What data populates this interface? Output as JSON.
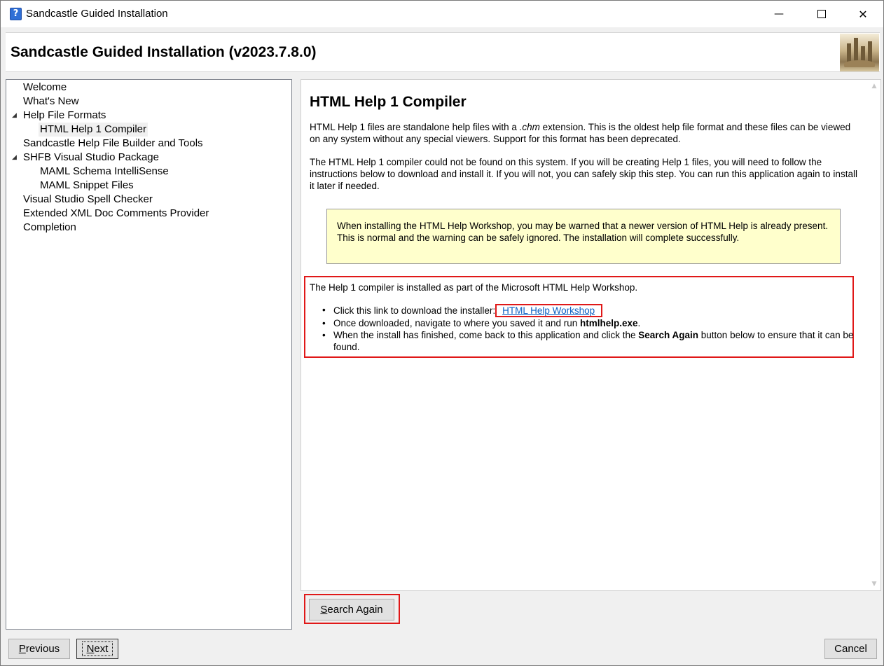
{
  "window": {
    "title": "Sandcastle Guided Installation",
    "controls": {
      "minimize": "—",
      "close": "✕"
    }
  },
  "header": {
    "title": "Sandcastle Guided Installation (v2023.7.8.0)"
  },
  "tree": {
    "items": [
      {
        "label": "Welcome"
      },
      {
        "label": "What's New"
      },
      {
        "label": "Help File Formats",
        "expander": "◢"
      },
      {
        "label": "HTML Help 1 Compiler"
      },
      {
        "label": "Sandcastle Help File Builder and Tools"
      },
      {
        "label": "SHFB Visual Studio Package",
        "expander": "◢"
      },
      {
        "label": "MAML Schema IntelliSense"
      },
      {
        "label": "MAML Snippet Files"
      },
      {
        "label": "Visual Studio Spell Checker"
      },
      {
        "label": "Extended XML Doc Comments Provider"
      },
      {
        "label": "Completion"
      }
    ]
  },
  "content": {
    "title": "HTML Help 1 Compiler",
    "intro_pre": "HTML Help 1 files are standalone help files with a ",
    "intro_ext": ".chm",
    "intro_post": " extension. This is the oldest help file format and these files can be viewed on any system without any special viewers. Support for this format has been deprecated.",
    "not_found": "The HTML Help 1 compiler could not be found on this system. If you will be creating Help 1 files, you will need to follow the instructions below to download and install it. If you will not, you can safely skip this step. You can run this application again to install it later if needed.",
    "note": "When installing the HTML Help Workshop, you may be warned that a newer version of HTML Help is already present. This is normal and the warning can be safely ignored. The installation will complete successfully.",
    "installed_as": "The Help 1 compiler is installed as part of the Microsoft HTML Help Workshop.",
    "bullet1_pre": "Click this link to download the installer:",
    "bullet1_link": "HTML Help Workshop",
    "bullet2_pre": "Once downloaded, navigate to where you saved it and run ",
    "bullet2_bold": "htmlhelp.exe",
    "bullet2_post": ".",
    "bullet3_pre": "When the install has finished, come back to this application and click the ",
    "bullet3_bold": "Search Again",
    "bullet3_post": " button below to ensure that it can be found.",
    "scroll_up": "▲",
    "scroll_down": "▼"
  },
  "buttons": {
    "search_again_key": "S",
    "search_again_rest": "earch Again",
    "previous_key": "P",
    "previous_rest": "revious",
    "next_key": "N",
    "next_rest": "ext",
    "cancel": "Cancel"
  }
}
